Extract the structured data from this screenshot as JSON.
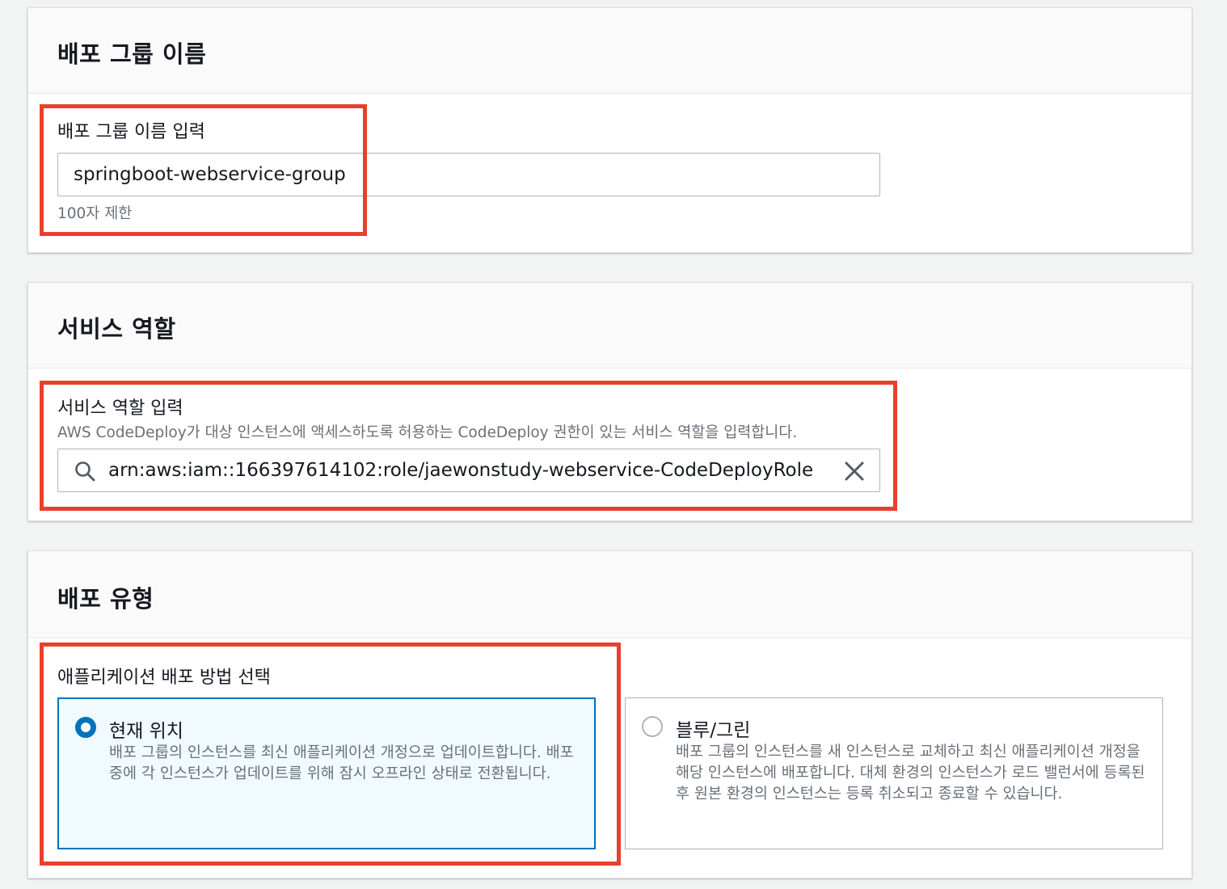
{
  "deployment_group_name": {
    "title": "배포 그룹 이름",
    "field_label": "배포 그룹 이름 입력",
    "value": "springboot-webservice-group",
    "constraint": "100자 제한"
  },
  "service_role": {
    "title": "서비스 역할",
    "field_label": "서비스 역할 입력",
    "description": "AWS CodeDeploy가 대상 인스턴스에 액세스하도록 허용하는 CodeDeploy 권한이 있는 서비스 역할을 입력합니다.",
    "value": "arn:aws:iam::166397614102:role/jaewonstudy-webservice-CodeDeployRole",
    "search_icon": "search-icon",
    "clear_icon": "close-icon"
  },
  "deployment_type": {
    "title": "배포 유형",
    "field_label": "애플리케이션 배포 방법 선택",
    "options": [
      {
        "label": "현재 위치",
        "description": "배포 그룹의 인스턴스를 최신 애플리케이션 개정으로 업데이트합니다. 배포 중에 각 인스턴스가 업데이트를 위해 잠시 오프라인 상태로 전환됩니다.",
        "selected": true
      },
      {
        "label": "블루/그린",
        "description": "배포 그룹의 인스턴스를 새 인스턴스로 교체하고 최신 애플리케이션 개정을 해당 인스턴스에 배포합니다. 대체 환경의 인스턴스가 로드 밸런서에 등록된 후 원본 환경의 인스턴스는 등록 취소되고 종료할 수 있습니다.",
        "selected": false
      }
    ]
  },
  "colors": {
    "highlight_border": "#e8402e",
    "selected_accent": "#0073bb",
    "selected_tile_bg": "#f1faff"
  }
}
